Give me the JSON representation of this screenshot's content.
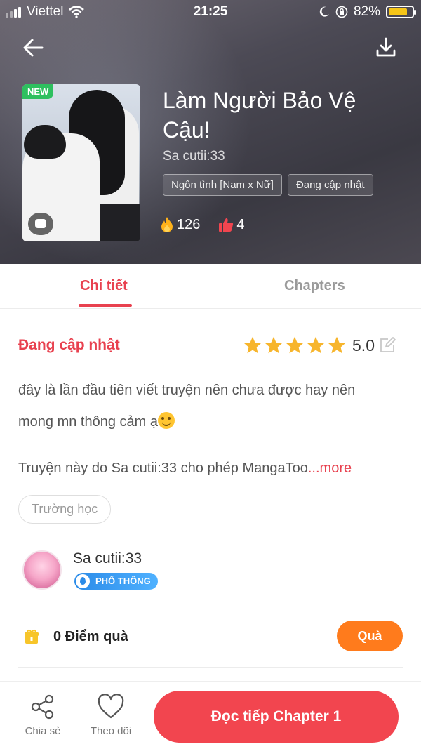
{
  "status_bar": {
    "carrier": "Viettel",
    "time": "21:25",
    "battery": "82%",
    "battery_level": 0.82
  },
  "header": {
    "new_badge": "NEW",
    "title": "Làm Người Bảo Vệ Cậu!",
    "author": "Sa cutii:33",
    "tags": [
      "Ngôn tình [Nam x Nữ]",
      "Đang cập nhật"
    ],
    "stats": {
      "fire_count": "126",
      "like_count": "4"
    }
  },
  "tabs": [
    {
      "label": "Chi tiết",
      "active": true
    },
    {
      "label": "Chapters",
      "active": false
    }
  ],
  "detail": {
    "status": "Đang cập nhật",
    "rating": "5.0",
    "stars": 5,
    "description_line1": "đây là lần đầu tiên viết truyện nên chưa được hay nên",
    "description_line2": "mong mn thông cảm ạ",
    "copyright_text": "Truyện này do Sa cutii:33 cho phép MangaToo",
    "more_label": "...more",
    "genre_chip": "Trường học"
  },
  "author_card": {
    "name": "Sa cutii:33",
    "level": "PHỔ THÔNG"
  },
  "points": {
    "text": "0 Điểm quà",
    "button": "Quà"
  },
  "bottom_bar": {
    "share": "Chia sẻ",
    "follow": "Theo dõi",
    "read": "Đọc tiếp Chapter 1"
  },
  "colors": {
    "accent": "#e8414f",
    "gift_button": "#ff7b1c",
    "read_button": "#f2454f",
    "level_badge": "#2b8be8"
  }
}
